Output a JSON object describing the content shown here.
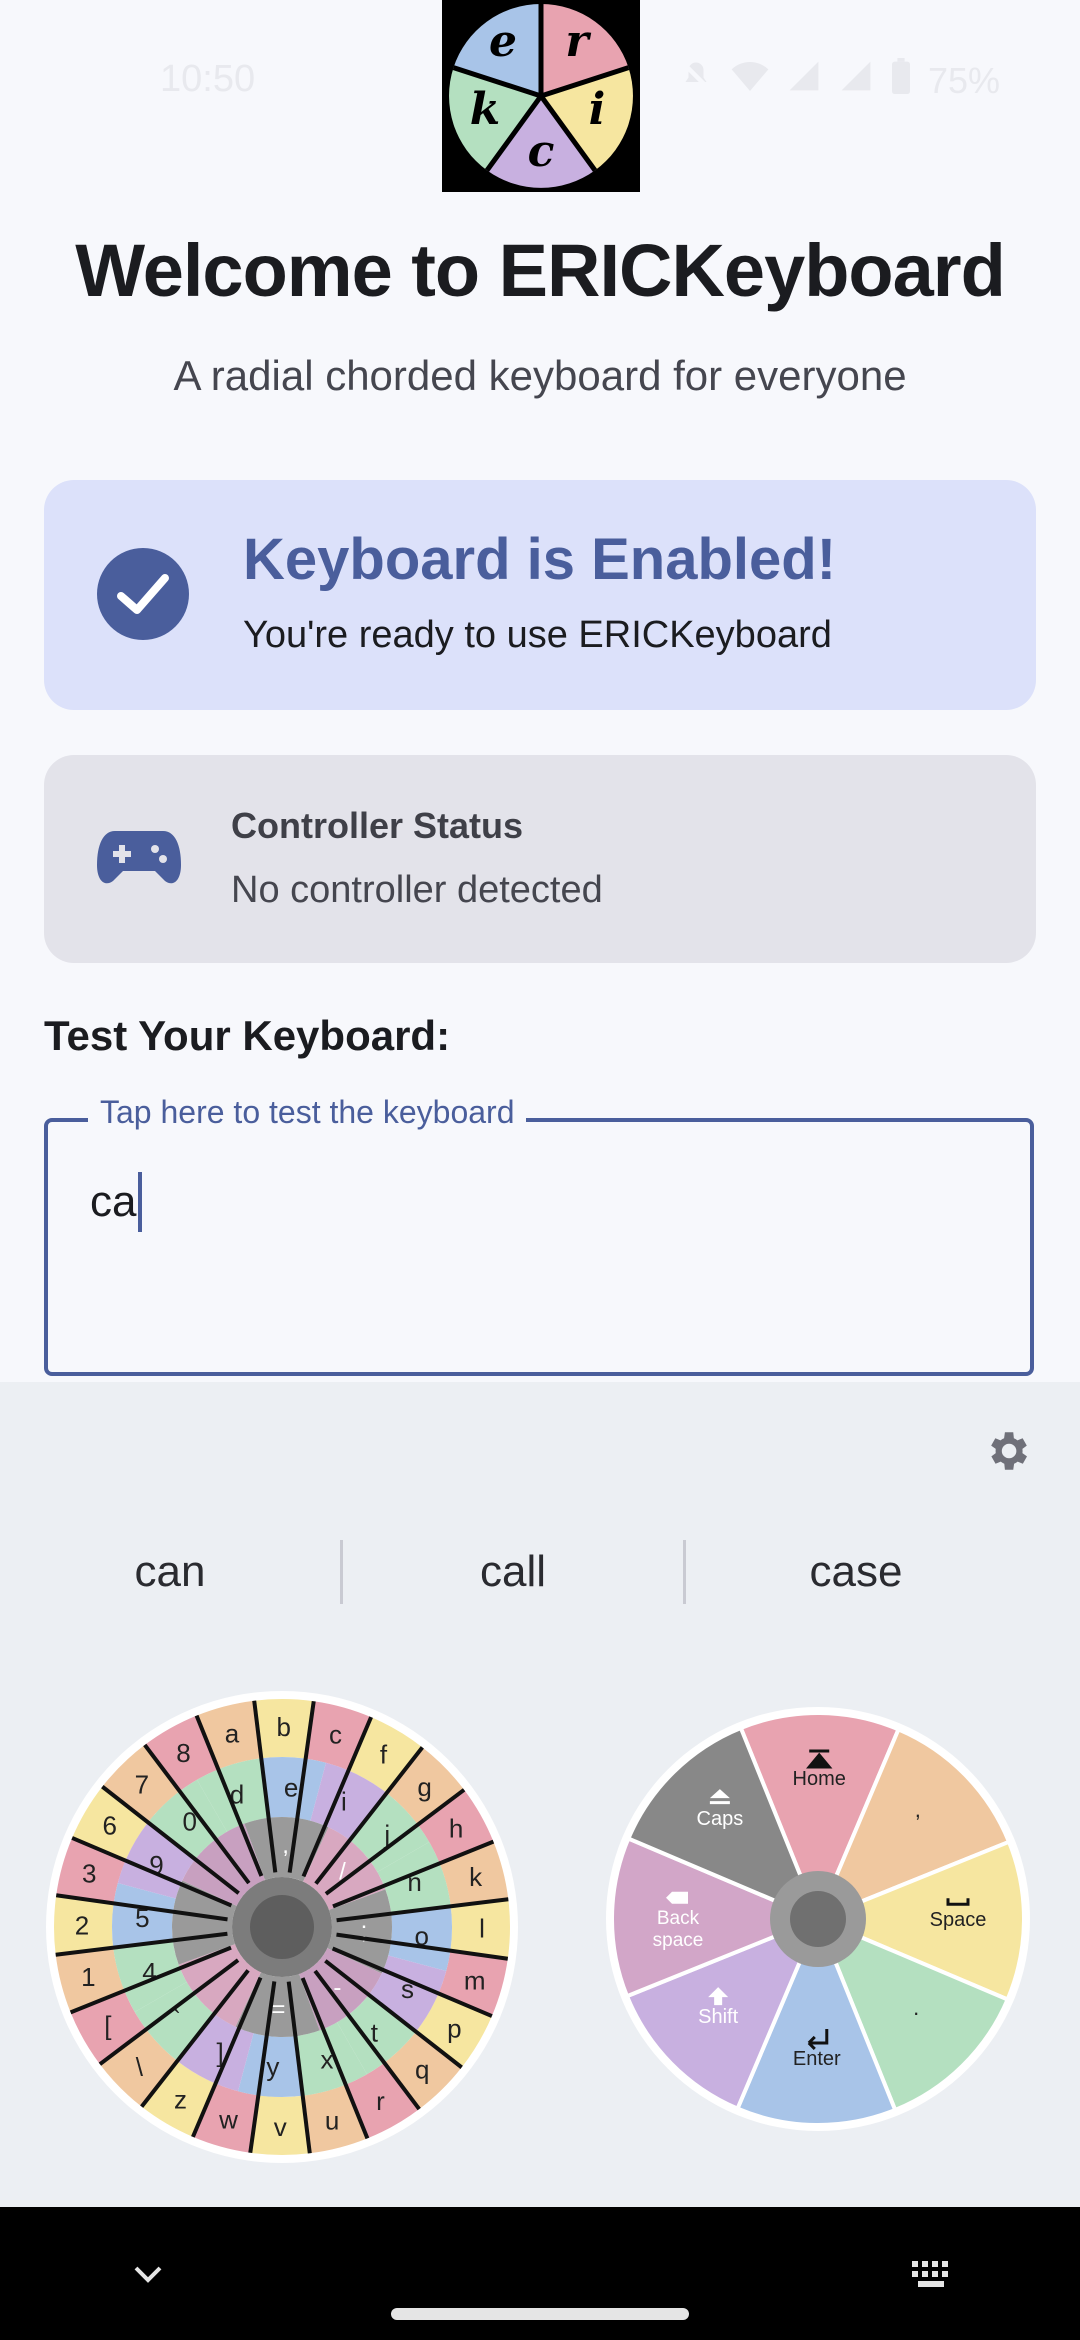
{
  "status_bar": {
    "time": "10:50",
    "battery": "75%"
  },
  "logo": {
    "letters": [
      "e",
      "r",
      "k",
      "i",
      "c"
    ]
  },
  "header": {
    "title": "Welcome to ERICKeyboard",
    "subtitle": "A radial chorded keyboard for everyone"
  },
  "enabled_card": {
    "title": "Keyboard is Enabled!",
    "subtitle": "You're ready to use ERICKeyboard"
  },
  "controller_card": {
    "title": "Controller Status",
    "status": "No controller detected"
  },
  "test": {
    "label": "Test Your Keyboard:",
    "legend": "Tap here to test the keyboard",
    "value": "ca"
  },
  "suggestions": [
    "can",
    "call",
    "case"
  ],
  "keyboard": {
    "letters_wheel": {
      "outer": [
        "a",
        "b",
        "c",
        "f",
        "g",
        "h",
        "k",
        "l",
        "m",
        "p",
        "q",
        "r",
        "u",
        "v",
        "w",
        "z",
        "\\",
        "[",
        "1",
        "2",
        "3",
        "6",
        "7",
        "8"
      ],
      "middle": [
        "d",
        "e",
        "i",
        "j",
        "n",
        "o",
        "s",
        "t",
        "x",
        "y",
        "]",
        "`",
        "4",
        "5",
        "9",
        "0"
      ],
      "inner": [
        ",",
        "/",
        ";",
        "-",
        "=",
        "",
        "",
        ""
      ]
    },
    "actions_wheel": {
      "home": "Home",
      "comma": ",",
      "space": "Space",
      "period": ".",
      "enter": "Enter",
      "shift": "Shift",
      "backspace_line1": "Back",
      "backspace_line2": "space",
      "caps": "Caps"
    }
  },
  "colors": {
    "accent": "#4a5e9c",
    "enabled_card_bg": "#dce1fa",
    "controller_card_bg": "#e3e3ea",
    "keyboard_bg": "#eceff3",
    "wheel_pink": "#e8a3b0",
    "wheel_orange": "#f0c8a0",
    "wheel_yellow": "#f6e6a0",
    "wheel_green": "#b4e0c0",
    "wheel_blue": "#a8c4e8",
    "wheel_purple": "#c8b0e0",
    "wheel_gray": "#888888"
  }
}
